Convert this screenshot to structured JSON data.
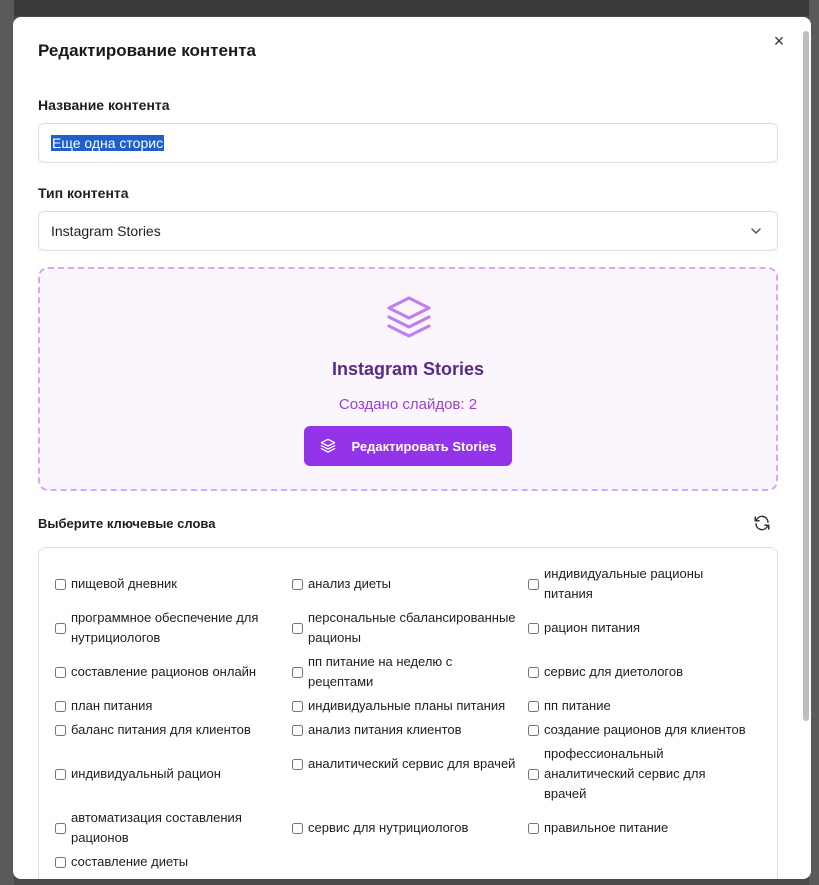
{
  "modal": {
    "title": "Редактирование контента",
    "close_glyph": "×"
  },
  "name_field": {
    "label": "Название контента",
    "value": "Еще одна сторис"
  },
  "type_field": {
    "label": "Тип контента",
    "value": "Instagram Stories"
  },
  "stories": {
    "icon": "layers-icon",
    "title": "Instagram Stories",
    "count_text": "Создано слайдов: 2",
    "edit_button": "Редактировать Stories"
  },
  "keywords": {
    "label": "Выберите ключевые слова",
    "items": [
      "пищевой дневник",
      "анализ диеты",
      "индивидуальные рационы питания",
      "программное обеспечение для нутрициологов",
      "персональные сбалансированные рационы",
      "рацион питания",
      "составление рационов онлайн",
      "пп питание на неделю с рецептами",
      "сервис для диетологов",
      "план питания",
      "индивидуальные планы питания",
      "пп питание",
      "баланс питания для клиентов",
      "анализ питания клиентов",
      "создание рационов для клиентов",
      "индивидуальный рацион",
      "аналитический сервис для врачей",
      "профессиональный аналитический сервис для врачей",
      "автоматизация составления рационов",
      "сервис для нутрициологов",
      "правильное питание",
      "составление диеты"
    ]
  },
  "colors": {
    "accent": "#9333ea",
    "stories_title": "#5b2a86",
    "stories_box_bg": "#fbf5fd",
    "dashed_border": "#dba7f5"
  }
}
